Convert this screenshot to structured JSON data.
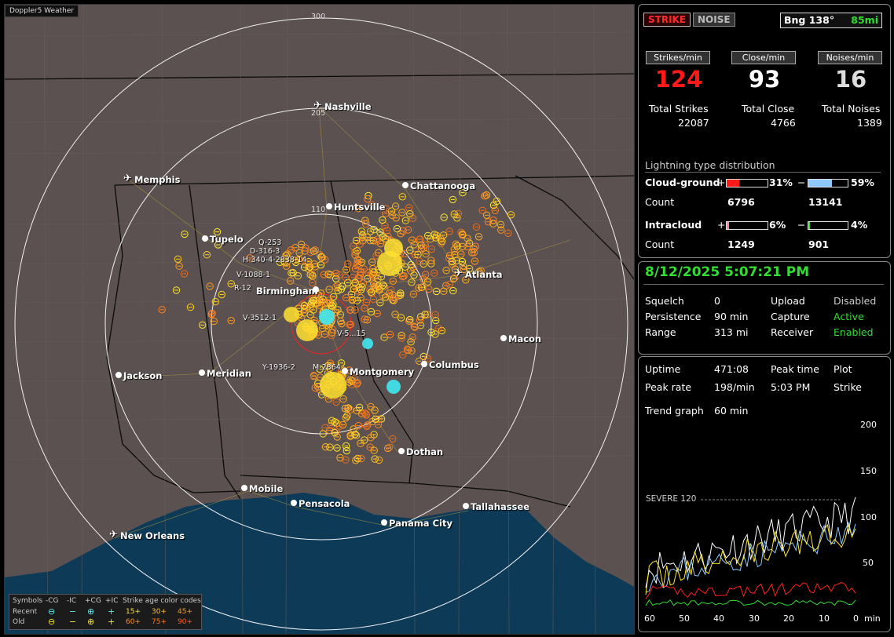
{
  "app_title": "Doppler5 Weather",
  "map": {
    "range_labels": [
      "300",
      "205",
      "110"
    ],
    "cities": [
      {
        "name": "Nashville",
        "kind": "airport"
      },
      {
        "name": "Memphis",
        "kind": "airport"
      },
      {
        "name": "Chattanooga",
        "kind": "city"
      },
      {
        "name": "Huntsville",
        "kind": "city"
      },
      {
        "name": "Tupelo",
        "kind": "city"
      },
      {
        "name": "Atlanta",
        "kind": "airport"
      },
      {
        "name": "Birmingham",
        "kind": "city"
      },
      {
        "name": "Macon",
        "kind": "city"
      },
      {
        "name": "Jackson",
        "kind": "city"
      },
      {
        "name": "Meridian",
        "kind": "city"
      },
      {
        "name": "Montgomery",
        "kind": "city"
      },
      {
        "name": "Columbus",
        "kind": "city"
      },
      {
        "name": "Dothan",
        "kind": "city"
      },
      {
        "name": "Mobile",
        "kind": "city"
      },
      {
        "name": "Pensacola",
        "kind": "city"
      },
      {
        "name": "Tallahassee",
        "kind": "city"
      },
      {
        "name": "Panama City",
        "kind": "city"
      },
      {
        "name": "New Orleans",
        "kind": "airport"
      }
    ],
    "storm_labels": [
      "Q-253",
      "D-316-3",
      "H-340-4-2838-14",
      "V-1088-1",
      "R-12",
      "V-3512-1",
      "V-5...15",
      "Y-1936-2",
      "M-2864"
    ]
  },
  "legend": {
    "row_header": [
      "Symbols",
      "-CG",
      "-IC",
      "+CG",
      "+IC",
      "Strike age color codes"
    ],
    "recent_label": "Recent",
    "old_label": "Old",
    "recent_ages": [
      "15+",
      "30+",
      "45+"
    ],
    "old_ages": [
      "60+",
      "75+",
      "90+"
    ]
  },
  "top": {
    "strike_tab": "STRIKE",
    "noise_tab": "NOISE",
    "bearing": "Bng 138°",
    "distance": "85mi",
    "strikes_min_label": "Strikes/min",
    "close_min_label": "Close/min",
    "noises_min_label": "Noises/min",
    "strikes_min": "124",
    "close_min": "93",
    "noises_min": "16",
    "total_strikes_label": "Total Strikes",
    "total_close_label": "Total Close",
    "total_noises_label": "Total Noises",
    "total_strikes": "22087",
    "total_close": "4766",
    "total_noises": "1389",
    "dist_title": "Lightning type distribution",
    "cg_label": "Cloud-ground",
    "ic_label": "Intracloud",
    "count_label": "Count",
    "plus": "+",
    "minus": "−",
    "cg_pos_pct": "31%",
    "cg_neg_pct": "59%",
    "ic_pos_pct": "6%",
    "ic_neg_pct": "4%",
    "cg_pos_count": "6796",
    "cg_neg_count": "13141",
    "ic_pos_count": "1249",
    "ic_neg_count": "901",
    "cg_pos_frac": 0.31,
    "cg_neg_frac": 0.59,
    "ic_pos_frac": 0.06,
    "ic_neg_frac": 0.04
  },
  "status": {
    "datetime": "8/12/2025 5:07:21 PM",
    "squelch_label": "Squelch",
    "squelch": "0",
    "persistence_label": "Persistence",
    "persistence": "90 min",
    "range_label": "Range",
    "range": "313 mi",
    "upload_label": "Upload",
    "upload": "Disabled",
    "capture_label": "Capture",
    "capture": "Active",
    "receiver_label": "Receiver",
    "receiver": "Enabled"
  },
  "trend": {
    "uptime_label": "Uptime",
    "uptime": "471:08",
    "peak_time_label": "Peak time",
    "peak_time": "5:03 PM",
    "plot_label": "Plot",
    "plot": "Strike",
    "peak_rate_label": "Peak rate",
    "peak_rate": "198/min",
    "trend_graph_label": "Trend graph",
    "trend_graph": "60 min",
    "severe_label": "SEVERE 120",
    "y_ticks": [
      "200",
      "150",
      "100",
      "50"
    ],
    "x_ticks": [
      "60",
      "50",
      "40",
      "30",
      "20",
      "10",
      "0"
    ],
    "x_unit": "min"
  },
  "colors": {
    "strike_red": "#ff1a1a",
    "active_green": "#33dd33",
    "cg_pos": "#ff1a1a",
    "cg_neg": "#8ec8ff",
    "ic_pos": "#ff7fb0",
    "ic_neg": "#33dd33"
  }
}
